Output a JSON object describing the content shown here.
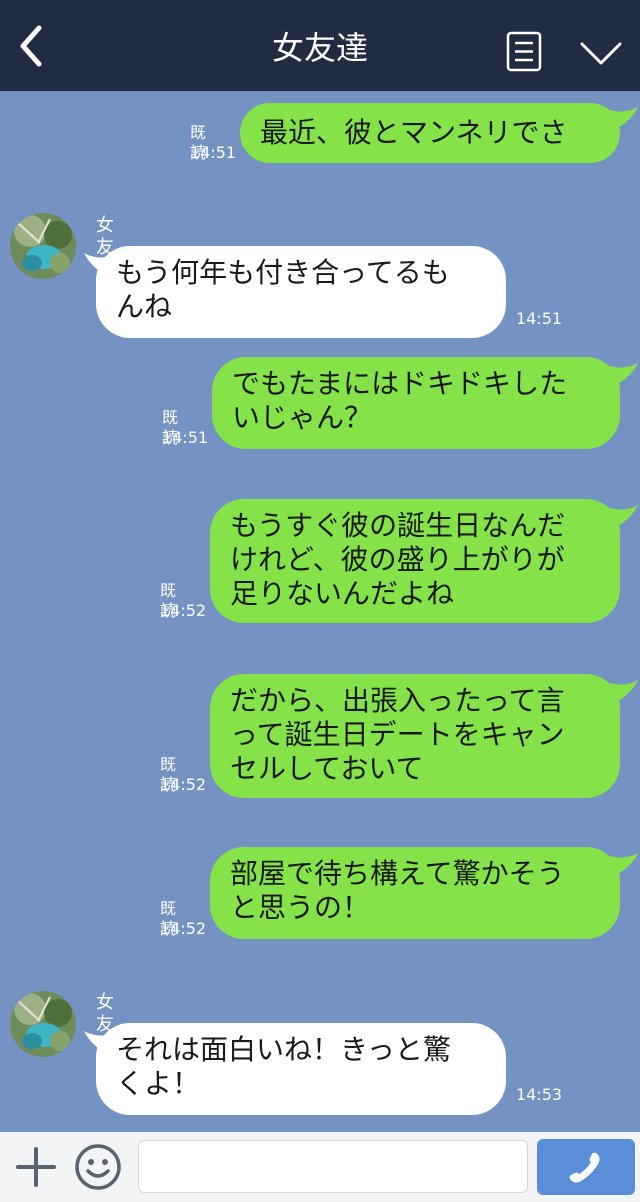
{
  "header": {
    "back_icon": "chevron-left-icon",
    "title": "女友達",
    "menu_icon": "list-icon",
    "dropdown_icon": "chevron-down-icon"
  },
  "colors": {
    "header_bg": "#212b42",
    "chat_bg": "#7493c3",
    "outgoing_bubble": "#85e249",
    "incoming_bubble": "#ffffff",
    "send_button": "#5b8ed9"
  },
  "messages": [
    {
      "direction": "out",
      "text": "最近、彼とマンネリでさ",
      "read": "既読",
      "time": "14:51"
    },
    {
      "direction": "in",
      "sender": "女友達",
      "text": "もう何年も付き合ってるも\nんね",
      "time": "14:51"
    },
    {
      "direction": "out",
      "text": "でもたまにはドキドキした\nいじゃん？",
      "read": "既読",
      "time": "14:51"
    },
    {
      "direction": "out",
      "text": "もうすぐ彼の誕生日なんだ\nけれど、彼の盛り上がりが\n足りないんだよね",
      "read": "既読",
      "time": "14:52"
    },
    {
      "direction": "out",
      "text": "だから、出張入ったって言\nって誕生日デートをキャン\nセルしておいて",
      "read": "既読",
      "time": "14:52"
    },
    {
      "direction": "out",
      "text": "部屋で待ち構えて驚かそう\nと思うの！",
      "read": "既読",
      "time": "14:52"
    },
    {
      "direction": "in",
      "sender": "女友達",
      "text": "それは面白いね！きっと驚\nくよ！",
      "time": "14:53"
    }
  ],
  "input_bar": {
    "add_icon": "plus-icon",
    "emoji_icon": "smiley-icon",
    "message_value": "",
    "call_icon": "phone-icon"
  }
}
